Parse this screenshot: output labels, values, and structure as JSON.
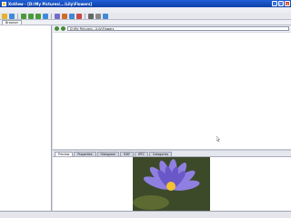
{
  "window": {
    "title": "XnView - [D:\\My Pictures\\...\\Lily\\Flowers]"
  },
  "menu": [],
  "toolbar": {
    "icons": [
      "folder-icon",
      "home-icon",
      "back-icon",
      "forward-icon",
      "up-icon",
      "refresh-icon",
      "view-icon",
      "filter-icon",
      "slideshow-icon",
      "convert-icon",
      "print-icon",
      "settings-icon",
      "help-icon"
    ]
  },
  "tabs": {
    "browser": "Browser"
  },
  "address": {
    "path": "D:\\My Pictures\\...\\Lily\\Flowers"
  },
  "tree": {
    "items": []
  },
  "thumbnails": [],
  "preview": {
    "tabs": [
      "Preview",
      "Properties",
      "Histogram",
      "EXIF",
      "IPTC",
      "Categories"
    ]
  },
  "status": {
    "cells": []
  },
  "colors": {
    "titlebar": "#1f5fd6",
    "selection": "#2e63c9",
    "folder": "#f2c94c"
  }
}
